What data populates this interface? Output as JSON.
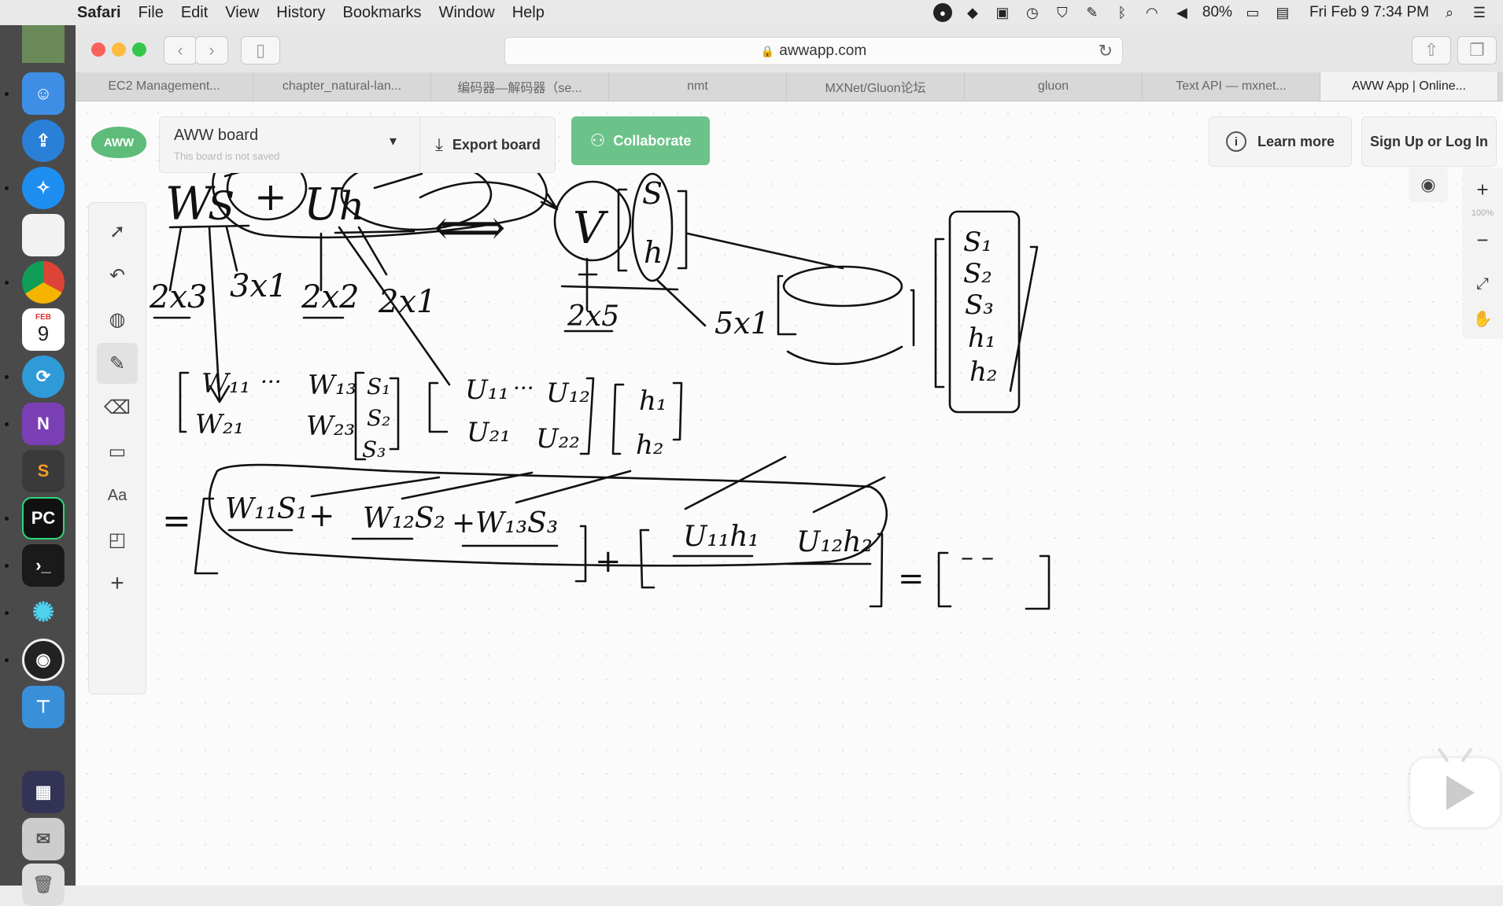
{
  "menubar": {
    "app_name": "Safari",
    "items": [
      "File",
      "Edit",
      "View",
      "History",
      "Bookmarks",
      "Window",
      "Help"
    ],
    "battery": "80%",
    "datetime": "Fri Feb 9  7:34 PM"
  },
  "dock": {
    "apps": [
      "finder-icon",
      "migration-icon",
      "safari-icon",
      "notes-icon",
      "chrome-icon",
      "calendar-icon",
      "network-icon",
      "onenote-icon",
      "sublime-icon",
      "pycharm-icon",
      "terminal-icon",
      "gear-flower-icon",
      "obs-icon",
      "keynote-icon",
      "screen-icon",
      "preview-icon",
      "trash-icon"
    ],
    "calendar_month": "FEB",
    "calendar_day": "9"
  },
  "safari": {
    "url": "awwapp.com",
    "tabs": [
      {
        "label": "EC2 Management..."
      },
      {
        "label": "chapter_natural-lan..."
      },
      {
        "label": "编码器—解码器（se..."
      },
      {
        "label": "nmt"
      },
      {
        "label": "MXNet/Gluon论坛"
      },
      {
        "label": "gluon"
      },
      {
        "label": "Text API — mxnet..."
      },
      {
        "label": "AWW App | Online..."
      }
    ],
    "active_tab_index": 7
  },
  "aww": {
    "logo": "AWW",
    "board_title": "AWW board",
    "board_subtitle": "This board is not saved",
    "export_label": "Export board",
    "collaborate_label": "Collaborate",
    "learn_more_label": "Learn more",
    "signup_label": "Sign Up or Log In",
    "zoom_level": "100%",
    "tools": [
      "select-icon",
      "undo-icon",
      "palette-icon",
      "pen-icon",
      "eraser-icon",
      "rectangle-icon",
      "text-icon",
      "sticky-note-icon",
      "add-icon"
    ],
    "text_tool_label": "Aa",
    "active_tool": "pen-icon"
  },
  "whiteboard": {
    "top_formula": [
      "W",
      "S",
      "+",
      "U",
      "h"
    ],
    "equivalence": "⟺",
    "v_label": "V",
    "stack_s": "S",
    "stack_h": "h",
    "dims": [
      "2x3",
      "3x1",
      "2x2",
      "2x1",
      "2x5",
      "5x1"
    ],
    "w_matrix": [
      "W₁₁",
      "···",
      "W₁₃",
      "W₂₁",
      "W₂₃"
    ],
    "s_vector": [
      "S₁",
      "S₂",
      "S₃"
    ],
    "u_matrix": [
      "U₁₁",
      "···",
      "U₁₂",
      "U₂₁",
      "U₂₂"
    ],
    "h_vector": [
      "h₁",
      "h₂"
    ],
    "big_vector": [
      "S₁",
      "S₂",
      "S₃",
      "h₁",
      "h₂"
    ],
    "expansion_terms": [
      "=",
      "W₁₁S₁",
      "+",
      "W₁₂S₂",
      "+W₁₃S₃",
      "+",
      "U₁₁h₁",
      "U₁₂h₂",
      "="
    ],
    "result_dashes": "– –"
  }
}
